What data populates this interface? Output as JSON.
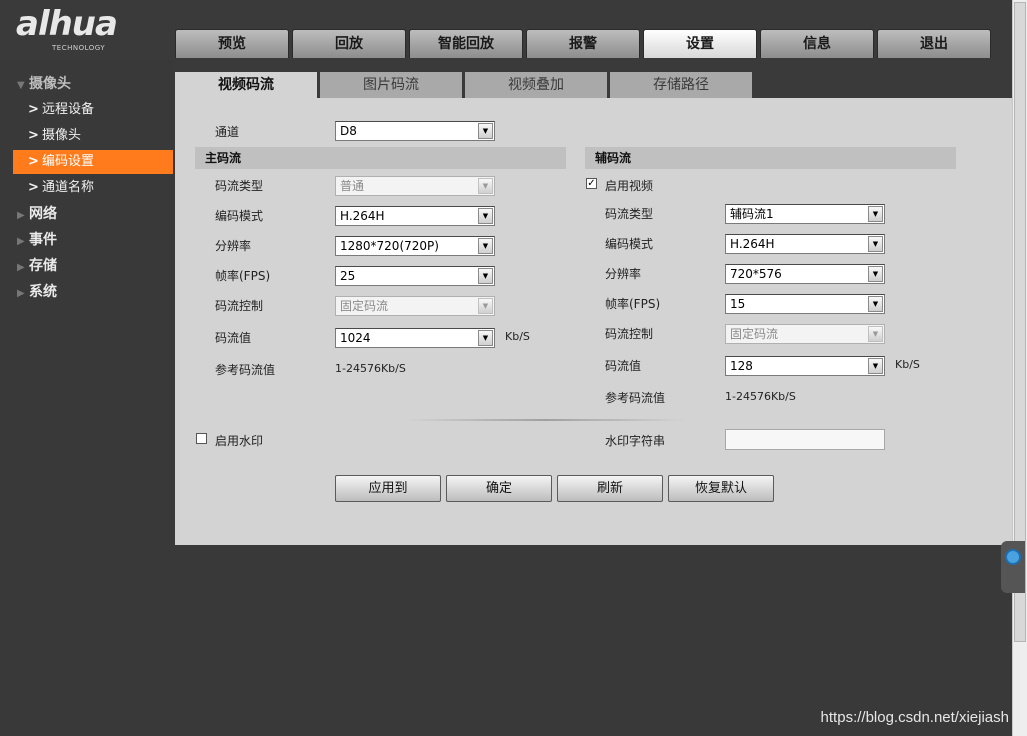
{
  "logo": {
    "text": "alhua",
    "subtext": "TECHNOLOGY"
  },
  "topnav": [
    "预览",
    "回放",
    "智能回放",
    "报警",
    "设置",
    "信息",
    "退出"
  ],
  "topnav_active": "设置",
  "sidebar": {
    "camera_header": "摄像头",
    "camera_items": [
      "远程设备",
      "摄像头",
      "编码设置",
      "通道名称"
    ],
    "active_item": "编码设置",
    "categories": [
      "网络",
      "事件",
      "存储",
      "系统"
    ]
  },
  "subtabs": [
    "视频码流",
    "图片码流",
    "视频叠加",
    "存储路径"
  ],
  "subtab_active": "视频码流",
  "channel": {
    "label": "通道",
    "value": "D8"
  },
  "main_stream": {
    "title": "主码流",
    "stream_type": {
      "label": "码流类型",
      "value": "普通"
    },
    "encode_mode": {
      "label": "编码模式",
      "value": "H.264H"
    },
    "resolution": {
      "label": "分辨率",
      "value": "1280*720(720P)"
    },
    "fps": {
      "label": "帧率(FPS)",
      "value": "25"
    },
    "bitrate_control": {
      "label": "码流控制",
      "value": "固定码流"
    },
    "bitrate": {
      "label": "码流值",
      "value": "1024",
      "unit": "Kb/S"
    },
    "ref_bitrate": {
      "label": "参考码流值",
      "value": "1-24576Kb/S"
    }
  },
  "sub_stream": {
    "title": "辅码流",
    "enable_video": {
      "label": "启用视频",
      "checked": true,
      "mark": "✓"
    },
    "stream_type": {
      "label": "码流类型",
      "value": "辅码流1"
    },
    "encode_mode": {
      "label": "编码模式",
      "value": "H.264H"
    },
    "resolution": {
      "label": "分辨率",
      "value": "720*576"
    },
    "fps": {
      "label": "帧率(FPS)",
      "value": "15"
    },
    "bitrate_control": {
      "label": "码流控制",
      "value": "固定码流"
    },
    "bitrate": {
      "label": "码流值",
      "value": "128",
      "unit": "Kb/S"
    },
    "ref_bitrate": {
      "label": "参考码流值",
      "value": "1-24576Kb/S"
    }
  },
  "watermark": {
    "enable_label": "启用水印",
    "enabled": false,
    "string_label": "水印字符串",
    "string_value": ""
  },
  "buttons": {
    "apply_to": "应用到",
    "ok": "确定",
    "refresh": "刷新",
    "default": "恢复默认"
  },
  "page_watermark": "https://blog.csdn.net/xiejiash",
  "colors": {
    "active_orange": "#ff7b1c",
    "panel_bg": "#d3d3d3",
    "page_bg": "#393939"
  }
}
